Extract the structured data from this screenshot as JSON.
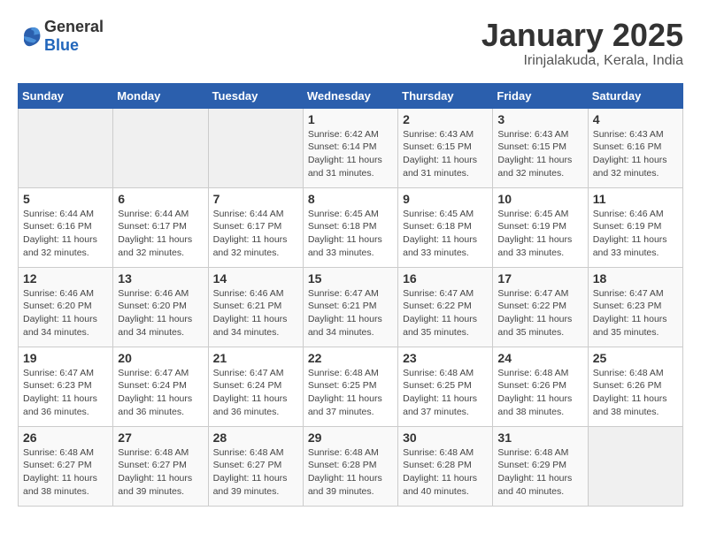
{
  "header": {
    "logo_general": "General",
    "logo_blue": "Blue",
    "title": "January 2025",
    "subtitle": "Irinjalakuda, Kerala, India"
  },
  "days_of_week": [
    "Sunday",
    "Monday",
    "Tuesday",
    "Wednesday",
    "Thursday",
    "Friday",
    "Saturday"
  ],
  "weeks": [
    [
      {
        "num": "",
        "info": ""
      },
      {
        "num": "",
        "info": ""
      },
      {
        "num": "",
        "info": ""
      },
      {
        "num": "1",
        "info": "Sunrise: 6:42 AM\nSunset: 6:14 PM\nDaylight: 11 hours\nand 31 minutes."
      },
      {
        "num": "2",
        "info": "Sunrise: 6:43 AM\nSunset: 6:15 PM\nDaylight: 11 hours\nand 31 minutes."
      },
      {
        "num": "3",
        "info": "Sunrise: 6:43 AM\nSunset: 6:15 PM\nDaylight: 11 hours\nand 32 minutes."
      },
      {
        "num": "4",
        "info": "Sunrise: 6:43 AM\nSunset: 6:16 PM\nDaylight: 11 hours\nand 32 minutes."
      }
    ],
    [
      {
        "num": "5",
        "info": "Sunrise: 6:44 AM\nSunset: 6:16 PM\nDaylight: 11 hours\nand 32 minutes."
      },
      {
        "num": "6",
        "info": "Sunrise: 6:44 AM\nSunset: 6:17 PM\nDaylight: 11 hours\nand 32 minutes."
      },
      {
        "num": "7",
        "info": "Sunrise: 6:44 AM\nSunset: 6:17 PM\nDaylight: 11 hours\nand 32 minutes."
      },
      {
        "num": "8",
        "info": "Sunrise: 6:45 AM\nSunset: 6:18 PM\nDaylight: 11 hours\nand 33 minutes."
      },
      {
        "num": "9",
        "info": "Sunrise: 6:45 AM\nSunset: 6:18 PM\nDaylight: 11 hours\nand 33 minutes."
      },
      {
        "num": "10",
        "info": "Sunrise: 6:45 AM\nSunset: 6:19 PM\nDaylight: 11 hours\nand 33 minutes."
      },
      {
        "num": "11",
        "info": "Sunrise: 6:46 AM\nSunset: 6:19 PM\nDaylight: 11 hours\nand 33 minutes."
      }
    ],
    [
      {
        "num": "12",
        "info": "Sunrise: 6:46 AM\nSunset: 6:20 PM\nDaylight: 11 hours\nand 34 minutes."
      },
      {
        "num": "13",
        "info": "Sunrise: 6:46 AM\nSunset: 6:20 PM\nDaylight: 11 hours\nand 34 minutes."
      },
      {
        "num": "14",
        "info": "Sunrise: 6:46 AM\nSunset: 6:21 PM\nDaylight: 11 hours\nand 34 minutes."
      },
      {
        "num": "15",
        "info": "Sunrise: 6:47 AM\nSunset: 6:21 PM\nDaylight: 11 hours\nand 34 minutes."
      },
      {
        "num": "16",
        "info": "Sunrise: 6:47 AM\nSunset: 6:22 PM\nDaylight: 11 hours\nand 35 minutes."
      },
      {
        "num": "17",
        "info": "Sunrise: 6:47 AM\nSunset: 6:22 PM\nDaylight: 11 hours\nand 35 minutes."
      },
      {
        "num": "18",
        "info": "Sunrise: 6:47 AM\nSunset: 6:23 PM\nDaylight: 11 hours\nand 35 minutes."
      }
    ],
    [
      {
        "num": "19",
        "info": "Sunrise: 6:47 AM\nSunset: 6:23 PM\nDaylight: 11 hours\nand 36 minutes."
      },
      {
        "num": "20",
        "info": "Sunrise: 6:47 AM\nSunset: 6:24 PM\nDaylight: 11 hours\nand 36 minutes."
      },
      {
        "num": "21",
        "info": "Sunrise: 6:47 AM\nSunset: 6:24 PM\nDaylight: 11 hours\nand 36 minutes."
      },
      {
        "num": "22",
        "info": "Sunrise: 6:48 AM\nSunset: 6:25 PM\nDaylight: 11 hours\nand 37 minutes."
      },
      {
        "num": "23",
        "info": "Sunrise: 6:48 AM\nSunset: 6:25 PM\nDaylight: 11 hours\nand 37 minutes."
      },
      {
        "num": "24",
        "info": "Sunrise: 6:48 AM\nSunset: 6:26 PM\nDaylight: 11 hours\nand 38 minutes."
      },
      {
        "num": "25",
        "info": "Sunrise: 6:48 AM\nSunset: 6:26 PM\nDaylight: 11 hours\nand 38 minutes."
      }
    ],
    [
      {
        "num": "26",
        "info": "Sunrise: 6:48 AM\nSunset: 6:27 PM\nDaylight: 11 hours\nand 38 minutes."
      },
      {
        "num": "27",
        "info": "Sunrise: 6:48 AM\nSunset: 6:27 PM\nDaylight: 11 hours\nand 39 minutes."
      },
      {
        "num": "28",
        "info": "Sunrise: 6:48 AM\nSunset: 6:27 PM\nDaylight: 11 hours\nand 39 minutes."
      },
      {
        "num": "29",
        "info": "Sunrise: 6:48 AM\nSunset: 6:28 PM\nDaylight: 11 hours\nand 39 minutes."
      },
      {
        "num": "30",
        "info": "Sunrise: 6:48 AM\nSunset: 6:28 PM\nDaylight: 11 hours\nand 40 minutes."
      },
      {
        "num": "31",
        "info": "Sunrise: 6:48 AM\nSunset: 6:29 PM\nDaylight: 11 hours\nand 40 minutes."
      },
      {
        "num": "",
        "info": ""
      }
    ]
  ]
}
